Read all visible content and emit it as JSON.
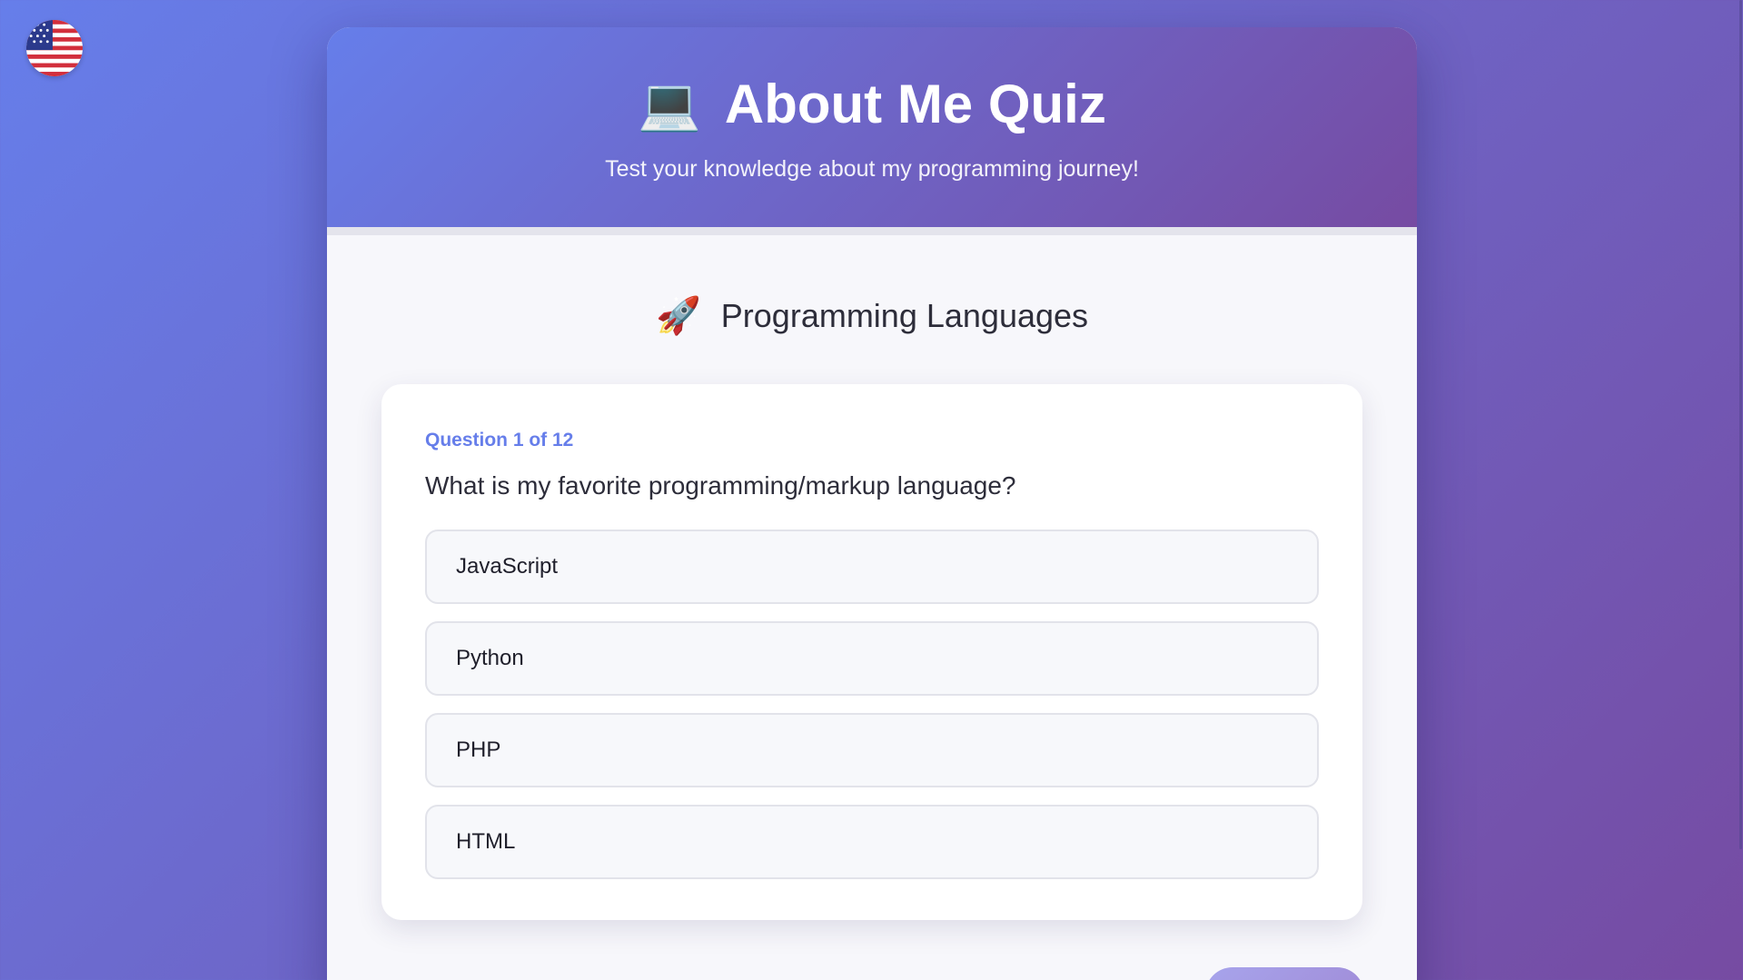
{
  "language": {
    "flag_icon": "us-flag-icon"
  },
  "header": {
    "title_icon": "💻",
    "title": "About Me Quiz",
    "subtitle": "Test your knowledge about my programming journey!"
  },
  "progress": {
    "fraction": 0
  },
  "section": {
    "icon": "🚀",
    "title": "Programming Languages"
  },
  "question": {
    "counter": "Question 1 of 12",
    "text": "What is my favorite programming/markup language?",
    "options": [
      {
        "label": "JavaScript"
      },
      {
        "label": "Python"
      },
      {
        "label": "PHP"
      },
      {
        "label": "HTML"
      }
    ]
  },
  "colors": {
    "accent": "#667eea",
    "gradient_start": "#667eea",
    "gradient_end": "#764ba2"
  }
}
